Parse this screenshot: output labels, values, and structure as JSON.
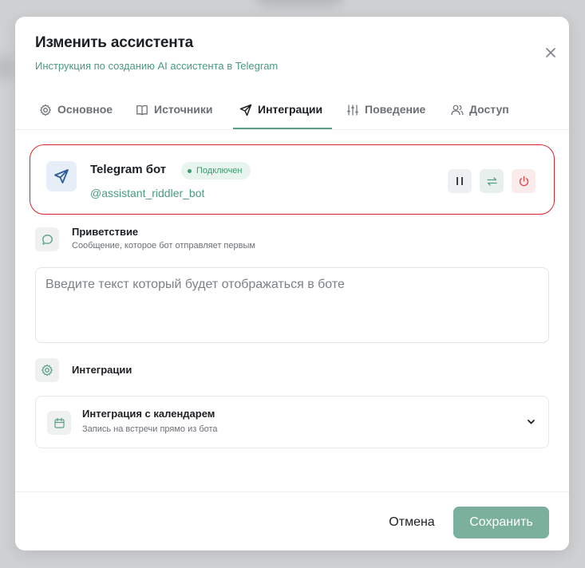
{
  "modal": {
    "title": "Изменить ассистента",
    "subtitle": "Инструкция по созданию AI ассистента в Telegram"
  },
  "tabs": [
    {
      "label": "Основное",
      "icon": "gear-icon"
    },
    {
      "label": "Источники",
      "icon": "book-icon"
    },
    {
      "label": "Интеграции",
      "icon": "send-icon",
      "active": true
    },
    {
      "label": "Поведение",
      "icon": "sliders-icon"
    },
    {
      "label": "Доступ",
      "icon": "users-icon"
    }
  ],
  "telegram": {
    "name": "Telegram бот",
    "status": "Подключен",
    "handle": "@assistant_riddler_bot"
  },
  "greeting": {
    "title": "Приветствие",
    "description": "Сообщение, которое бот отправляет первым",
    "placeholder": "Введите текст который будет отображаться в боте"
  },
  "integrations": {
    "title": "Интеграции",
    "calendar": {
      "title": "Интеграция с календарем",
      "description": "Запись на встречи прямо из бота"
    }
  },
  "footer": {
    "cancel": "Отмена",
    "save": "Сохранить"
  },
  "colors": {
    "accent": "#5a9e88",
    "save_button": "#7bb09c",
    "status_green": "#3e9a6d",
    "highlight_red": "#d6262b",
    "power_red": "#e5484d"
  }
}
